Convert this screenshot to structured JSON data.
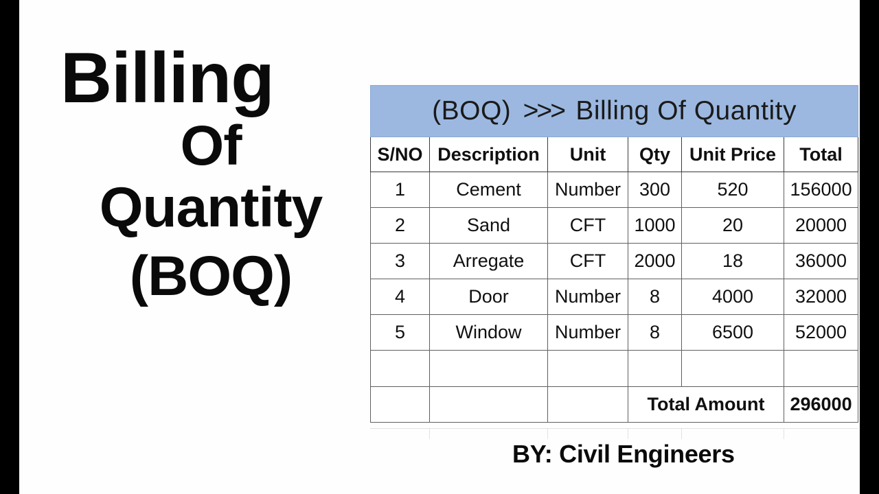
{
  "poster": {
    "title_lines": [
      "Billing",
      "Of",
      "Quantity",
      "(BOQ)"
    ],
    "byline": "BY: Civil Engineers",
    "accent_blue": "#9CB8E0",
    "text_color": "#0A0A0A",
    "border_color": "#5F5F5F"
  },
  "sheet": {
    "banner": {
      "prefix": "(BOQ)",
      "arrows": ">>>",
      "suffix": "Billing Of Quantity",
      "full_text": "(BOQ)  >>>  Billing Of Quantity"
    },
    "columns": [
      "S/NO",
      "Description",
      "Unit",
      "Qty",
      "Unit Price",
      "Total"
    ],
    "rows": [
      {
        "sno": "1",
        "description": "Cement",
        "unit": "Number",
        "qty": "300",
        "unit_price": "520",
        "total": "156000"
      },
      {
        "sno": "2",
        "description": "Sand",
        "unit": "CFT",
        "qty": "1000",
        "unit_price": "20",
        "total": "20000"
      },
      {
        "sno": "3",
        "description": "Arregate",
        "unit": "CFT",
        "qty": "2000",
        "unit_price": "18",
        "total": "36000"
      },
      {
        "sno": "4",
        "description": "Door",
        "unit": "Number",
        "qty": "8",
        "unit_price": "4000",
        "total": "32000"
      },
      {
        "sno": "5",
        "description": "Window",
        "unit": "Number",
        "qty": "8",
        "unit_price": "6500",
        "total": "52000"
      }
    ],
    "blank_row": {
      "sno": "",
      "description": "",
      "unit": "",
      "qty": "",
      "unit_price": "",
      "total": ""
    },
    "total_row": {
      "sno": "",
      "description": "",
      "unit": "",
      "label": "Total Amount",
      "amount": "296000"
    }
  }
}
